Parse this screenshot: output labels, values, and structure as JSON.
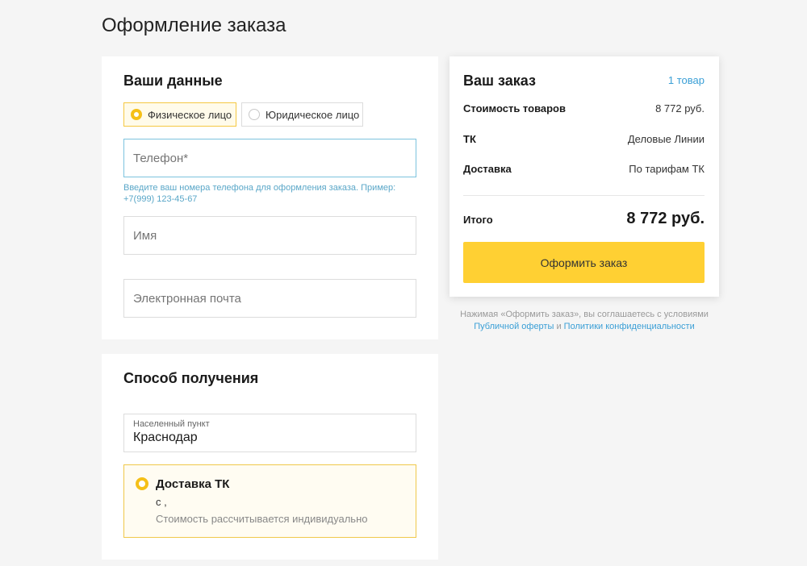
{
  "page": {
    "title": "Оформление заказа"
  },
  "customer": {
    "title": "Ваши данные",
    "person_types": [
      {
        "label": "Физическое лицо",
        "selected": true
      },
      {
        "label": "Юридическое лицо",
        "selected": false
      }
    ],
    "phone": {
      "placeholder": "Телефон*",
      "value": ""
    },
    "phone_hint": "Введите ваш номера телефона для оформления заказа. Пример: +7(999) 123-45-67",
    "name": {
      "placeholder": "Имя",
      "value": ""
    },
    "email": {
      "placeholder": "Электронная почта",
      "value": ""
    }
  },
  "delivery": {
    "title": "Способ получения",
    "city_label": "Населенный пункт",
    "city_value": "Краснодар",
    "option": {
      "name": "Доставка ТК",
      "date": "с ,",
      "cost_note": "Стоимость рассчитывается индивидуально",
      "selected": true
    }
  },
  "summary": {
    "title": "Ваш заказ",
    "items_count": "1 товар",
    "rows": [
      {
        "label": "Стоимость товаров",
        "value": "8 772 руб."
      },
      {
        "label": "ТК",
        "value": "Деловые Линии"
      },
      {
        "label": "Доставка",
        "value": "По тарифам ТК"
      }
    ],
    "total_label": "Итого",
    "total_value": "8 772 руб.",
    "submit_label": "Оформить заказ"
  },
  "agreement": {
    "text_before": "Нажимая «Оформить заказ», вы соглашаетесь с условиями",
    "offer_link": "Публичной оферты",
    "conjunction": "и",
    "privacy_link": "Политики конфиденциальности"
  },
  "colors": {
    "accent_yellow": "#ffd033",
    "link_blue": "#3a9fd6",
    "hint_blue": "#5aa7c8",
    "background": "#f5f5f5"
  }
}
